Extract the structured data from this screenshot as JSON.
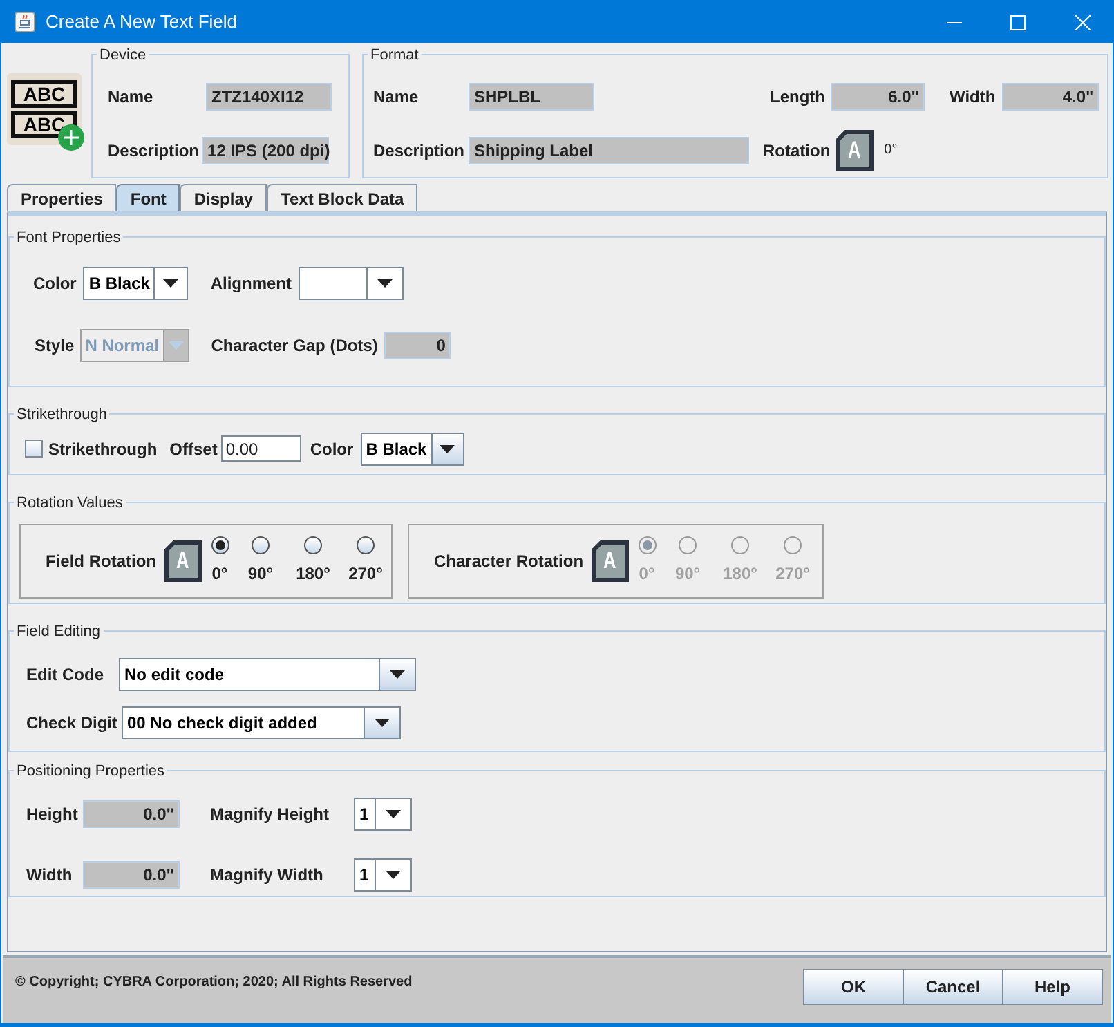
{
  "window": {
    "title": "Create A New Text Field"
  },
  "header_icon": {
    "lines": [
      "ABC",
      "ABC"
    ]
  },
  "device": {
    "legend": "Device",
    "fields": [
      {
        "label": "Name",
        "value": "ZTZ140XI12"
      },
      {
        "label": "Description",
        "value": "12 IPS (200 dpi)"
      }
    ]
  },
  "format": {
    "legend": "Format",
    "name": {
      "label": "Name",
      "value": "SHPLBL"
    },
    "description": {
      "label": "Description",
      "value": "Shipping Label"
    },
    "length": {
      "label": "Length",
      "value": "6.0\""
    },
    "width": {
      "label": "Width",
      "value": "4.0\""
    },
    "rotation": {
      "label": "Rotation",
      "icon_letter": "A",
      "value": "0°"
    }
  },
  "tabs": [
    {
      "label": "Properties",
      "selected": false
    },
    {
      "label": "Font",
      "selected": true
    },
    {
      "label": "Display",
      "selected": false
    },
    {
      "label": "Text Block Data",
      "selected": false
    }
  ],
  "font_properties": {
    "legend": "Font Properties",
    "color": {
      "label": "Color",
      "value": "B Black"
    },
    "alignment": {
      "label": "Alignment"
    },
    "style": {
      "label": "Style",
      "value": "N Normal",
      "disabled": true
    },
    "character_gap": {
      "label": "Character Gap (Dots)",
      "value": "0"
    }
  },
  "strikethrough": {
    "legend": "Strikethrough",
    "checkbox": {
      "label": "Strikethrough",
      "checked": false
    },
    "offset": {
      "label": "Offset",
      "value": "0.00"
    },
    "color": {
      "label": "Color",
      "value": "B Black"
    }
  },
  "rotation_values": {
    "legend": "Rotation Values",
    "groups": [
      {
        "label": "Field Rotation",
        "icon_letter": "A",
        "disabled": false,
        "options": [
          {
            "label": "0°",
            "selected": true
          },
          {
            "label": "90°",
            "selected": false
          },
          {
            "label": "180°",
            "selected": false
          },
          {
            "label": "270°",
            "selected": false
          }
        ]
      },
      {
        "label": "Character Rotation",
        "icon_letter": "A",
        "disabled": true,
        "options": [
          {
            "label": "0°",
            "selected": true
          },
          {
            "label": "90°",
            "selected": false
          },
          {
            "label": "180°",
            "selected": false
          },
          {
            "label": "270°",
            "selected": false
          }
        ]
      }
    ]
  },
  "field_editing": {
    "legend": "Field Editing",
    "edit_code": {
      "label": "Edit Code",
      "value": "No edit code"
    },
    "check_digit": {
      "label": "Check Digit",
      "value": "00 No check digit added"
    }
  },
  "positioning": {
    "legend": "Positioning Properties",
    "height": {
      "label": "Height",
      "value": "0.0\""
    },
    "magnify_height": {
      "label": "Magnify Height",
      "value": "1"
    },
    "width": {
      "label": "Width",
      "value": "0.0\""
    },
    "magnify_width": {
      "label": "Magnify Width",
      "value": "1"
    }
  },
  "footer": {
    "copyright": "© Copyright; CYBRA Corporation; 2020; All Rights Reserved",
    "buttons": [
      "OK",
      "Cancel",
      "Help"
    ]
  }
}
